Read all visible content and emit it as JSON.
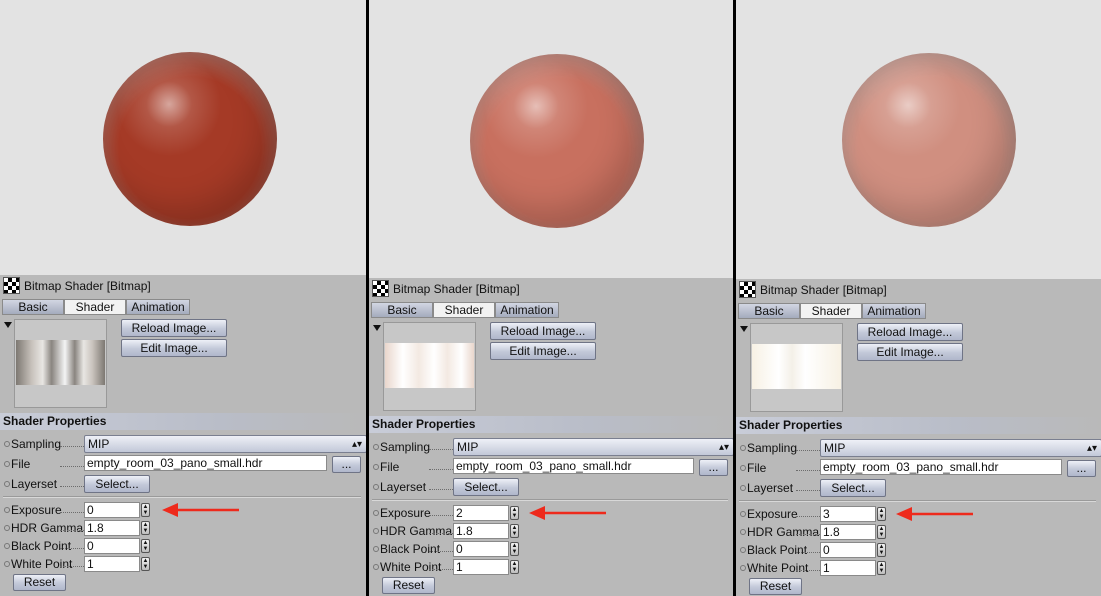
{
  "panels": [
    {
      "shader_title": "Bitmap Shader [Bitmap]",
      "tabs": {
        "basic": "Basic",
        "shader": "Shader",
        "animation": "Animation"
      },
      "reload_button": "Reload Image...",
      "edit_button": "Edit Image...",
      "section_header": "Shader Properties",
      "sampling_label": "Sampling",
      "sampling_value": "MIP",
      "file_label": "File",
      "file_value": "empty_room_03_pano_small.hdr",
      "browse_button": "...",
      "layerset_label": "Layerset",
      "select_button": "Select...",
      "exposure_label": "Exposure",
      "exposure_value": "0",
      "hdr_gamma_label": "HDR Gamma",
      "hdr_gamma_value": "1.8",
      "black_point_label": "Black Point",
      "black_point_value": "0",
      "white_point_label": "White Point",
      "white_point_value": "1",
      "reset_button": "Reset",
      "sphere_color": "#a53a26",
      "thumbnail_tone": "dark"
    },
    {
      "shader_title": "Bitmap Shader [Bitmap]",
      "tabs": {
        "basic": "Basic",
        "shader": "Shader",
        "animation": "Animation"
      },
      "reload_button": "Reload Image...",
      "edit_button": "Edit Image...",
      "section_header": "Shader Properties",
      "sampling_label": "Sampling",
      "sampling_value": "MIP",
      "file_label": "File",
      "file_value": "empty_room_03_pano_small.hdr",
      "browse_button": "...",
      "layerset_label": "Layerset",
      "select_button": "Select...",
      "exposure_label": "Exposure",
      "exposure_value": "2",
      "hdr_gamma_label": "HDR Gamma",
      "hdr_gamma_value": "1.8",
      "black_point_label": "Black Point",
      "black_point_value": "0",
      "white_point_label": "White Point",
      "white_point_value": "1",
      "reset_button": "Reset",
      "sphere_color": "#c8705f",
      "thumbnail_tone": "bright"
    },
    {
      "shader_title": "Bitmap Shader [Bitmap]",
      "tabs": {
        "basic": "Basic",
        "shader": "Shader",
        "animation": "Animation"
      },
      "reload_button": "Reload Image...",
      "edit_button": "Edit Image...",
      "section_header": "Shader Properties",
      "sampling_label": "Sampling",
      "sampling_value": "MIP",
      "file_label": "File",
      "file_value": "empty_room_03_pano_small.hdr",
      "browse_button": "...",
      "layerset_label": "Layerset",
      "select_button": "Select...",
      "exposure_label": "Exposure",
      "exposure_value": "3",
      "hdr_gamma_label": "HDR Gamma",
      "hdr_gamma_value": "1.8",
      "black_point_label": "Black Point",
      "black_point_value": "0",
      "white_point_label": "White Point",
      "white_point_value": "1",
      "reset_button": "Reset",
      "sphere_color": "#d08f80",
      "thumbnail_tone": "very-bright"
    }
  ],
  "colors": {
    "annotation_arrow": "#ee2a1c",
    "viewport_bg": "#e3e3e3",
    "panel_bg": "#b9b9b9"
  }
}
